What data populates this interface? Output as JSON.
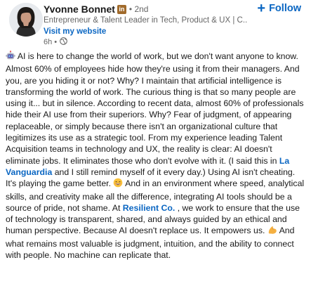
{
  "author": {
    "name": "Yvonne Bonnet",
    "badge": "in",
    "degree": "• 2nd",
    "headline": "Entrepreneur & Talent Leader in Tech, Product & UX | C...",
    "website_link": "Visit my website",
    "time": "6h •",
    "visibility_icon": "globe-icon"
  },
  "follow": {
    "plus": "+",
    "label": "Follow"
  },
  "post": {
    "seg1": " AI is here to change the world of work, but we don't want anyone to know. Almost 60% of employees hide how they're using it from their managers. And you, are you hiding it or not? Why? I maintain that artificial intelligence is transforming the world of work. The curious thing is that so many people are using it... but in silence. According to recent data, almost 60% of professionals hide their AI use from their superiors. Why? Fear of judgment, of appearing replaceable, or simply because there isn't an organizational culture that legitimizes its use as a strategic tool. From my experience leading Talent Acquisition teams in technology and UX, the reality is clear: AI doesn't eliminate jobs. It eliminates those who don't evolve with it. (I said this in ",
    "mention1": "La Vanguardia",
    "seg2": " and I still remind myself of it every day.) Using AI isn't cheating. It's playing the game better. ",
    "seg3": " And in an environment where speed, analytical skills, and creativity make all the difference, integrating AI tools should be a source of pride, not shame. At ",
    "mention2": "Resilient Co.",
    "seg4": " , we work to ensure that the use of technology is transparent, shared, and always guided by an ethical and human perspective. Because AI doesn't replace us. It empowers us. ",
    "seg5": " And what remains most valuable is judgment, intuition, and the ability to connect with people. No machine can replicate that."
  },
  "icons": {
    "lead_emoji": "robot-emoji-icon",
    "grin_emoji": "grinning-emoji-icon",
    "muscle_emoji": "flexed-bicep-emoji-icon"
  },
  "colors": {
    "link": "#0a66c2",
    "text": "#191919",
    "muted": "#666666",
    "badge": "#a16b2c"
  }
}
